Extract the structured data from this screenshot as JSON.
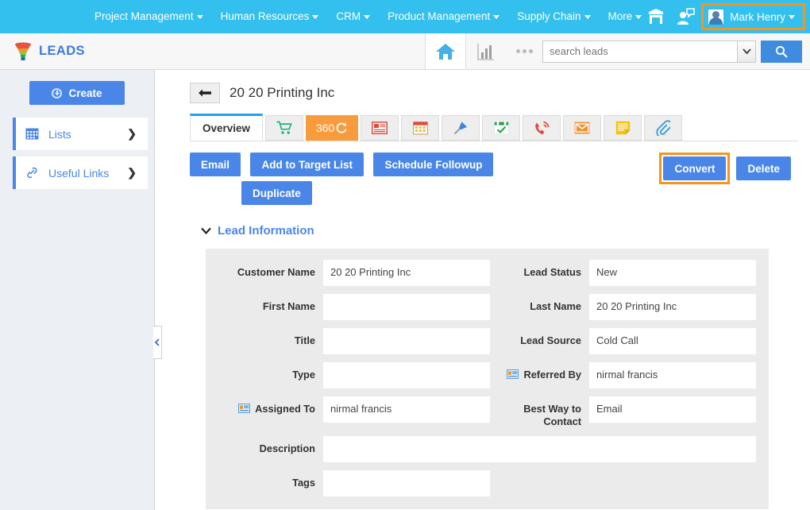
{
  "topnav": {
    "items": [
      {
        "label": "Project Management",
        "caret": true
      },
      {
        "label": "Human Resources",
        "caret": true
      },
      {
        "label": "CRM",
        "caret": true
      },
      {
        "label": "Product Management",
        "caret": true
      },
      {
        "label": "Supply Chain",
        "caret": true
      },
      {
        "label": "More",
        "caret": true
      }
    ],
    "shop_icon": "store-icon",
    "chat_icon": "user-chat-icon",
    "user": {
      "name": "Mark Henry",
      "avatar_icon": "avatar-icon",
      "caret": true
    },
    "background": "#33c0ee",
    "highlight_color": "#f7941e"
  },
  "modulebar": {
    "module_icon": "funnel-icon",
    "module_name": "LEADS",
    "home_icon": "home-icon",
    "chart_icon": "bar-chart-icon",
    "more_icon": "ellipsis-icon",
    "search": {
      "placeholder": "search leads",
      "value": "",
      "caret_icon": "chevron-down-icon",
      "button_icon": "search-icon"
    }
  },
  "sidebar": {
    "create_label": "Create",
    "create_icon": "plus-circle-icon",
    "items": [
      {
        "label": "Lists",
        "icon": "grid-icon",
        "chevron": "❯"
      },
      {
        "label": "Useful Links",
        "icon": "link-icon",
        "chevron": "❯"
      }
    ],
    "collapse_icon": "chevron-left-icon"
  },
  "record": {
    "back_icon": "arrow-left-icon",
    "title": "20 20 Printing Inc"
  },
  "tabs": [
    {
      "label": "Overview",
      "type": "text",
      "active": true,
      "icon": ""
    },
    {
      "label": "",
      "type": "icon",
      "icon": "shopping-cart-icon"
    },
    {
      "label": "360",
      "type": "text360",
      "icon": "refresh-icon"
    },
    {
      "label": "",
      "type": "icon",
      "icon": "newspaper-icon"
    },
    {
      "label": "",
      "type": "icon",
      "icon": "calendar-icon"
    },
    {
      "label": "",
      "type": "icon",
      "icon": "pin-icon"
    },
    {
      "label": "",
      "type": "icon",
      "icon": "calendar-check-icon"
    },
    {
      "label": "",
      "type": "icon",
      "icon": "phone-icon"
    },
    {
      "label": "",
      "type": "icon",
      "icon": "envelope-icon"
    },
    {
      "label": "",
      "type": "icon",
      "icon": "note-icon"
    },
    {
      "label": "",
      "type": "icon",
      "icon": "paperclip-icon"
    }
  ],
  "actions": {
    "email": "Email",
    "add_to_target_list": "Add to Target List",
    "schedule_followup": "Schedule Followup",
    "duplicate": "Duplicate",
    "convert": "Convert",
    "delete": "Delete",
    "convert_highlighted": true
  },
  "panel": {
    "title": "Lead Information",
    "collapse_icon": "chevron-down-icon",
    "fields": {
      "customer_name_label": "Customer Name",
      "customer_name_value": "20 20 Printing Inc",
      "lead_status_label": "Lead Status",
      "lead_status_value": "New",
      "first_name_label": "First Name",
      "first_name_value": "",
      "last_name_label": "Last Name",
      "last_name_value": "20 20 Printing Inc",
      "title_label": "Title",
      "title_value": "",
      "lead_source_label": "Lead Source",
      "lead_source_value": "Cold Call",
      "type_label": "Type",
      "type_value": "",
      "referred_by_label": "Referred By",
      "referred_by_value": "nirmal francis",
      "assigned_to_label": "Assigned To",
      "assigned_to_value": "nirmal francis",
      "best_way_label": "Best Way to Contact",
      "best_way_value": "Email",
      "description_label": "Description",
      "description_value": "",
      "tags_label": "Tags",
      "tags_value": ""
    }
  }
}
